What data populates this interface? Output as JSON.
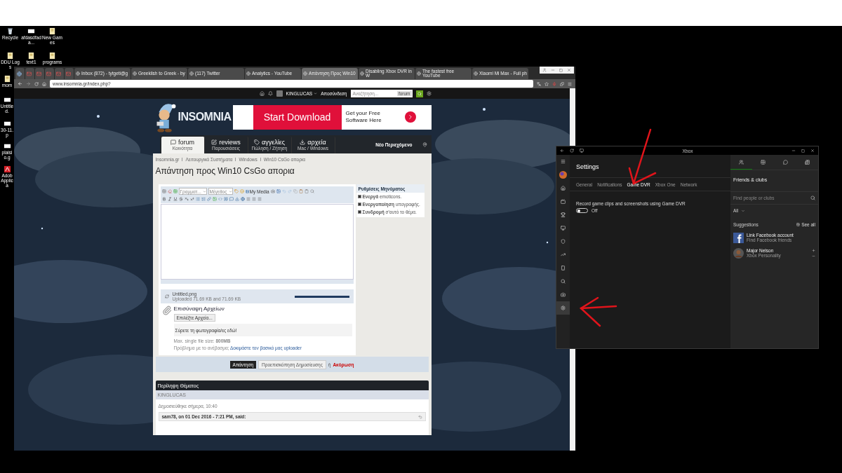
{
  "desktop": {
    "icons": [
      {
        "label": "Recycle",
        "kind": "bin"
      },
      {
        "label": "afdasdfada...",
        "kind": "file"
      },
      {
        "label": "New Games",
        "kind": "folder"
      },
      {
        "label": "DDU Logs",
        "kind": "folder"
      },
      {
        "label": "text1",
        "kind": "folder"
      },
      {
        "label": "programs",
        "kind": "folder"
      },
      {
        "label": "mom",
        "kind": "folder"
      },
      {
        "label": "Untitled.",
        "kind": "file"
      },
      {
        "label": "30-11.p",
        "kind": "file"
      },
      {
        "label": "plaisio.g",
        "kind": "file"
      },
      {
        "label": "Adob Applica",
        "kind": "app"
      }
    ]
  },
  "browser": {
    "tabs": [
      {
        "kind": "icon",
        "selected": false
      },
      {
        "kind": "mail",
        "selected": false
      },
      {
        "kind": "mail",
        "selected": false
      },
      {
        "kind": "mail",
        "selected": false
      },
      {
        "kind": "mail",
        "selected": false
      },
      {
        "kind": "mail",
        "selected": false
      },
      {
        "kind": "page",
        "label": "Inbox (872) - tytgeti@g",
        "selected": false
      },
      {
        "kind": "page",
        "label": "Greeklish to Greek - by",
        "selected": false
      },
      {
        "kind": "page",
        "label": "(117) Twitter",
        "selected": false
      },
      {
        "kind": "page",
        "label": "Analytics - YouTube",
        "selected": false
      },
      {
        "kind": "page",
        "label": "Απάντηση Προς Win10",
        "selected": true
      },
      {
        "kind": "page",
        "label": "Disabling Xbox DVR in W",
        "selected": false
      },
      {
        "kind": "page",
        "label": "The fastest free YouTube",
        "selected": false
      },
      {
        "kind": "page",
        "label": "Xiaomi Mi Max - Full ph",
        "selected": false
      }
    ],
    "address": "www.insomnia.gr/index.php?"
  },
  "forum": {
    "user": "KINGLUCAS",
    "logout": "Αποσύνδεση",
    "search_placeholder": "Αναζήτηση...",
    "search_scope": "forum",
    "logo": "INSOMNIA",
    "ad": {
      "button": "Start Download",
      "text": "Get your Free Software Here"
    },
    "nav": [
      {
        "label": "forum",
        "sub": "Κοινότητα",
        "kind": "forum",
        "selected": true
      },
      {
        "label": "reviews",
        "sub": "Παρουσιάσεις",
        "kind": "reviews",
        "selected": false
      },
      {
        "label": "αγγελίες",
        "sub": "Πώληση / Ζήτηση",
        "kind": "ads",
        "selected": false
      },
      {
        "label": "αρχεία",
        "sub": "Mac / Windows",
        "kind": "files",
        "selected": false
      }
    ],
    "nav_right": "Νέο Περιεχόμενο",
    "breadcrumbs": [
      "Insomnia.gr",
      "Λειτουργικά Συστήματα",
      "Windows",
      "Win10 CsGo απορια"
    ],
    "title": "Απάντηση προς Win10 CsGo απορια",
    "editor": {
      "font": "Γραμματ...",
      "size": "Μέγεθος",
      "media": "My Media"
    },
    "options": {
      "title": "Ρυθμίσεις Μηνύματος",
      "items": [
        {
          "text": "**Ενεργά** emoticons.",
          "checked": true
        },
        {
          "text": "**Ενεργοποίηση** υπογραφής.",
          "checked": true
        },
        {
          "text": "**Συνδρομή** σ'αυτό το θέμα.",
          "checked": true
        }
      ]
    },
    "upload": {
      "file": "Untitled.png",
      "status": "Uploaded 71.69 KB and 71.69 KB",
      "level": 1,
      "heading": "Επισύναψη Αρχείων",
      "choose": "Επιλέξτε Αρχεία...",
      "drop": "Σύρετε τη φωτογραφία/ες εδώ!",
      "max": "Max. single file size: **800MB**",
      "problem": "Πρόβλημα με το ανέβασμα;",
      "problem_link": "Δοκιμάστε τον βασικό μας uploader"
    },
    "actions": {
      "submit": "Απάντηση",
      "preview": "Προεπισκόπηση Δημοσίευσης",
      "or": "ή",
      "cancel": "Ακύρωση"
    },
    "summary": {
      "title": "Περίληψη Θέματος",
      "author": "KINGLUCAS",
      "posted": "Δημοσιεύθηκε σήμερα, 10:40",
      "quote": "sam78, on 01 Dec 2016 - 7:21 PM, said:"
    }
  },
  "xbox": {
    "title": "Xbox",
    "heading": "Settings",
    "rail": [
      {
        "kind": "menu",
        "selected": false
      },
      {
        "kind": "avatar",
        "selected": false
      },
      {
        "kind": "home",
        "selected": false
      },
      {
        "kind": "tv",
        "selected": false
      },
      {
        "kind": "trophy",
        "selected": false
      },
      {
        "kind": "screen",
        "selected": false
      },
      {
        "kind": "shield",
        "selected": false
      },
      {
        "kind": "trend",
        "selected": false
      },
      {
        "kind": "store",
        "selected": false
      },
      {
        "kind": "search",
        "selected": false
      },
      {
        "kind": "connect",
        "selected": false
      },
      {
        "kind": "settings",
        "selected": true
      }
    ],
    "tabs": [
      {
        "label": "General",
        "selected": false
      },
      {
        "label": "Notifications",
        "selected": false
      },
      {
        "label": "Game DVR",
        "selected": true
      },
      {
        "label": "Xbox One",
        "selected": false
      },
      {
        "label": "Network",
        "selected": false
      }
    ],
    "setting": "Record game clips and screenshots using Game DVR",
    "toggle": {
      "on": false,
      "label": "Off"
    },
    "friends": {
      "panel_tabs": [
        {
          "kind": "friends",
          "selected": true
        },
        {
          "kind": "party",
          "selected": false
        },
        {
          "kind": "messages",
          "selected": false
        },
        {
          "kind": "activity",
          "selected": false
        }
      ],
      "title": "Friends & clubs",
      "search_placeholder": "Find people or clubs",
      "filter": "All",
      "suggestions": "Suggestions",
      "see_all": "See all",
      "people": [
        {
          "name": "Link Facebook account",
          "detail": "Find Facebook friends",
          "kind": "facebook"
        },
        {
          "name": "Major Nelson",
          "detail": "Xbox Personality",
          "kind": "person"
        }
      ]
    }
  }
}
